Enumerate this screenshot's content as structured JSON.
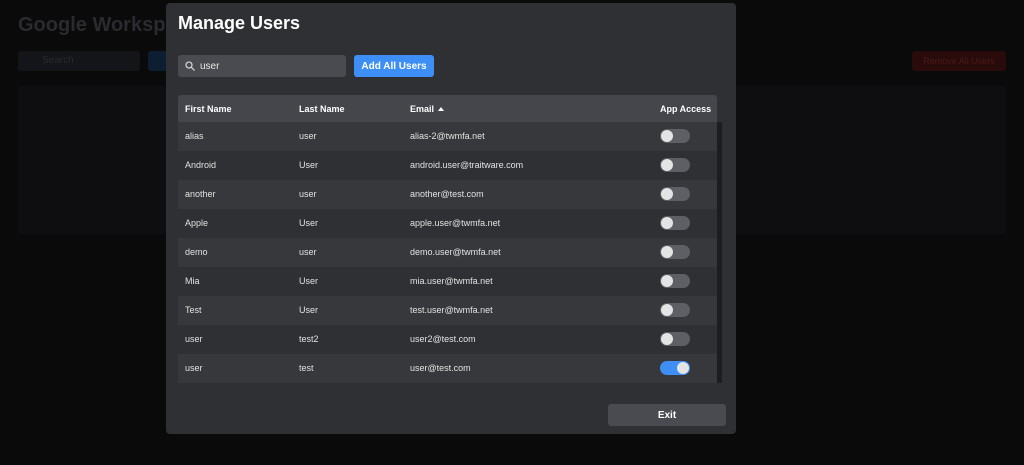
{
  "background": {
    "title": "Google Workspa",
    "search_placeholder": "Search",
    "remove_button": "Remove All Users"
  },
  "modal": {
    "title": "Manage Users",
    "search": {
      "value": "user",
      "icon": "search-icon"
    },
    "add_all_label": "Add All Users",
    "exit_label": "Exit",
    "columns": {
      "first_name": "First Name",
      "last_name": "Last Name",
      "email": "Email",
      "app_access": "App Access"
    },
    "sort": {
      "column": "email",
      "direction": "ascending"
    },
    "rows": [
      {
        "first": "alias",
        "last": "user",
        "email": "alias-2@twmfa.net",
        "access": false
      },
      {
        "first": "Android",
        "last": "User",
        "email": "android.user@traitware.com",
        "access": false
      },
      {
        "first": "another",
        "last": "user",
        "email": "another@test.com",
        "access": false
      },
      {
        "first": "Apple",
        "last": "User",
        "email": "apple.user@twmfa.net",
        "access": false
      },
      {
        "first": "demo",
        "last": "user",
        "email": "demo.user@twmfa.net",
        "access": false
      },
      {
        "first": "Mia",
        "last": "User",
        "email": "mia.user@twmfa.net",
        "access": false
      },
      {
        "first": "Test",
        "last": "User",
        "email": "test.user@twmfa.net",
        "access": false
      },
      {
        "first": "user",
        "last": "test2",
        "email": "user2@test.com",
        "access": false
      },
      {
        "first": "user",
        "last": "test",
        "email": "user@test.com",
        "access": true
      }
    ]
  },
  "colors": {
    "accent": "#3d8ff5",
    "modal_bg": "#2f3034",
    "header_bg": "#45464c"
  }
}
